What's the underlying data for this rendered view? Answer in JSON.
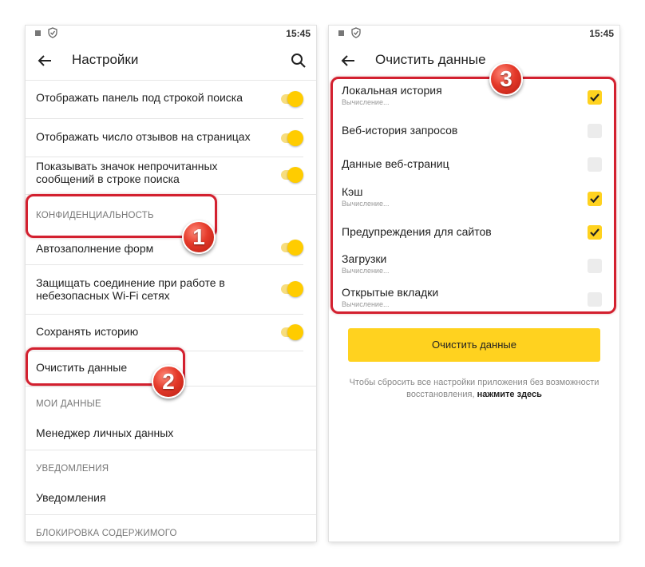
{
  "left_screen": {
    "status": {
      "time": "15:45"
    },
    "appbar": {
      "title": "Настройки"
    },
    "rows": {
      "panel_under_search": "Отображать панель под строкой поиска",
      "reviews_count": "Отображать число отзывов на страницах",
      "unread_icon": "Показывать значок непрочитанных сообщений в строке поиска",
      "privacy_section": "Конфиденциальность",
      "autofill": "Автозаполнение форм",
      "protect_wifi": "Защищать соединение при работе в небезопасных Wi-Fi сетях",
      "save_history": "Сохранять историю",
      "clear_data": "Очистить данные",
      "my_data_section": "Мои данные",
      "personal_data_manager": "Менеджер личных данных",
      "notifications_section": "Уведомления",
      "notifications": "Уведомления",
      "blocking_section": "Блокировка содержимого"
    },
    "toggles": {
      "panel_under_search": true,
      "reviews_count": true,
      "unread_icon": true,
      "autofill": true,
      "protect_wifi": true,
      "save_history": true
    }
  },
  "right_screen": {
    "status": {
      "time": "15:45"
    },
    "appbar": {
      "title": "Очистить данные"
    },
    "items": [
      {
        "label": "Локальная история",
        "sub": "Вычисление...",
        "checked": true
      },
      {
        "label": "Веб-история запросов",
        "sub": "",
        "checked": false
      },
      {
        "label": "Данные веб-страниц",
        "sub": "",
        "checked": false
      },
      {
        "label": "Кэш",
        "sub": "Вычисление...",
        "checked": true
      },
      {
        "label": "Предупреждения для сайтов",
        "sub": "",
        "checked": true
      },
      {
        "label": "Загрузки",
        "sub": "Вычисление...",
        "checked": false
      },
      {
        "label": "Открытые вкладки",
        "sub": "Вычисление...",
        "checked": false
      }
    ],
    "clear_button": "Очистить данные",
    "reset_note": "Чтобы сбросить все настройки приложения без возможности восстановления,",
    "reset_link": "нажмите здесь"
  },
  "badges": {
    "one": "1",
    "two": "2",
    "three": "3"
  },
  "colors": {
    "accent_yellow": "#ffcc00",
    "highlight_red": "#d3202f"
  }
}
